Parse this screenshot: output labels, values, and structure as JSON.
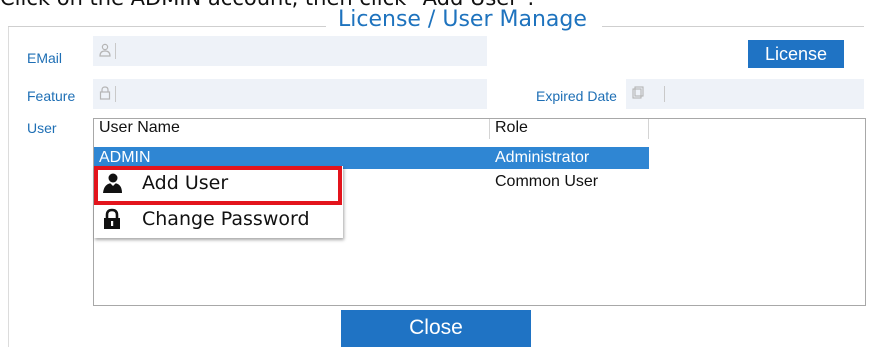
{
  "caption": "Click on the ADMIN account, then click \"Add User\".",
  "dialog": {
    "title": "License / User Manage",
    "labels": {
      "email": "EMail",
      "feature": "Feature",
      "expired": "Expired Date",
      "user": "User"
    },
    "buttons": {
      "license": "License",
      "close": "Close"
    }
  },
  "user_table": {
    "columns": [
      "User Name",
      "Role"
    ],
    "rows": [
      {
        "name": "ADMIN",
        "role": "Administrator",
        "selected": true
      },
      {
        "name": "",
        "role": "Common User",
        "selected": false
      }
    ]
  },
  "context_menu": {
    "items": [
      {
        "label": "Add User",
        "icon": "user-icon"
      },
      {
        "label": "Change Password",
        "icon": "lock-icon"
      }
    ]
  },
  "colors": {
    "accent": "#1f73c4",
    "selection": "#2f86d3",
    "highlight": "#e3141c"
  }
}
